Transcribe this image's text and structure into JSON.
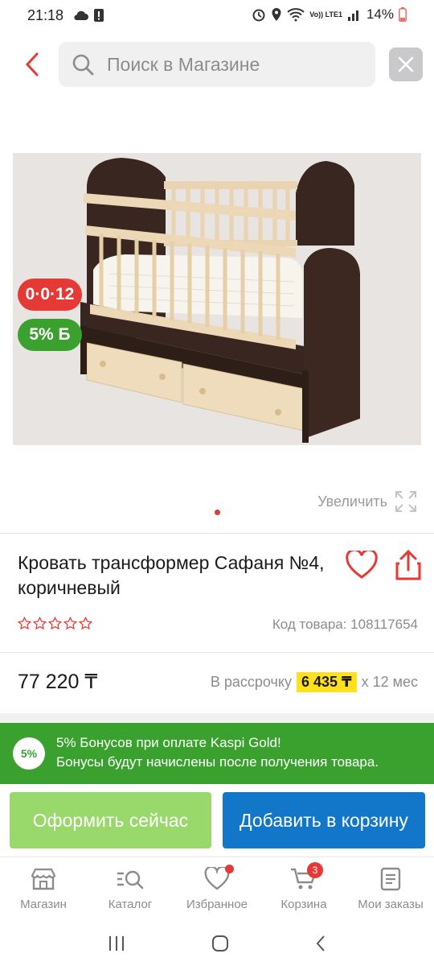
{
  "status_bar": {
    "time": "21:18",
    "battery": "14%",
    "network": "Vo)) LTE1"
  },
  "search": {
    "placeholder": "Поиск в Магазине"
  },
  "product": {
    "image_alt": "Кровать трансформер",
    "badge_installment": "0·0·12",
    "badge_bonus": "5% Б",
    "zoom_label": "Увеличить",
    "title": "Кровать трансформер Сафаня №4, коричневый",
    "rating_stars": 0,
    "sku": "Код товара: 108117654",
    "price": "77 220 ₸",
    "installment_prefix": "В рассрочку",
    "installment_amount": "6 435 ₸",
    "installment_suffix": "x 12 мес"
  },
  "bonus_banner": {
    "percent": "5%",
    "line1": "5% Бонусов при оплате Kaspi Gold!",
    "line2": "Бонусы будут начислены после получения товара."
  },
  "actions": {
    "checkout": "Оформить сейчас",
    "add_to_cart": "Добавить в корзину"
  },
  "bottom_nav": {
    "items": [
      {
        "label": "Магазин",
        "icon": "shop-icon"
      },
      {
        "label": "Каталог",
        "icon": "catalog-search-icon"
      },
      {
        "label": "Избранное",
        "icon": "heart-icon"
      },
      {
        "label": "Корзина",
        "icon": "cart-icon",
        "count": "3"
      },
      {
        "label": "Мои заказы",
        "icon": "orders-icon"
      }
    ]
  },
  "colors": {
    "brand_red": "#e53935",
    "bonus_green": "#3aa12f",
    "checkout_green": "#99d86a",
    "cart_blue": "#1277c9",
    "highlight_yellow": "#ffe11b"
  }
}
